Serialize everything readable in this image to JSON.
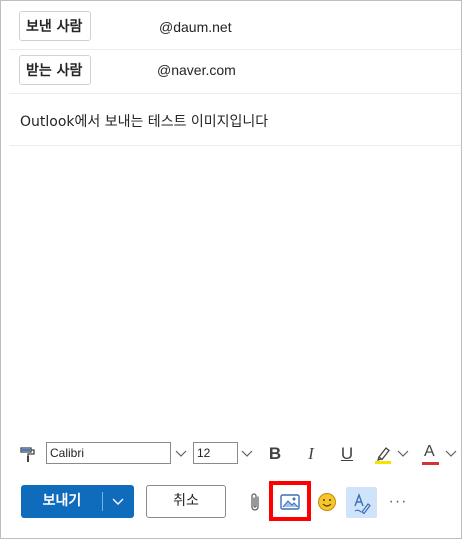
{
  "header": {
    "from_label": "보낸 사람",
    "from_address": "@daum.net",
    "to_label": "받는 사람",
    "to_address": "@naver.com"
  },
  "subject": "Outlook에서 보내는 테스트 이미지입니다",
  "format_toolbar": {
    "font_name": "Calibri",
    "font_size": "12",
    "icons": [
      "format-painter-icon",
      "chevron-down-icon",
      "bold-icon",
      "italic-icon",
      "underline-icon",
      "highlight-icon",
      "font-color-icon"
    ],
    "bold_label": "B",
    "italic_label": "I",
    "underline_label": "U",
    "font_color_label": "A",
    "highlight_color": "#f6e300",
    "font_color": "#d13438"
  },
  "actions": {
    "send_label": "보내기",
    "cancel_label": "취소",
    "more_label": "···",
    "icons": [
      "attach-icon",
      "insert-picture-icon",
      "emoji-icon",
      "editor-icon"
    ]
  },
  "colors": {
    "accent": "#0f6cbd",
    "highlight_box": "#ff0000",
    "editor_active_bg": "#cfe4fa"
  }
}
